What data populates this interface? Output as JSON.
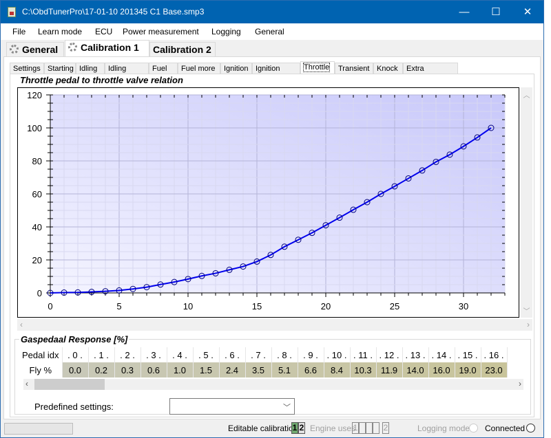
{
  "window": {
    "title": "C:\\ObdTunerPro\\17-01-10 201345 C1 Base.smp3",
    "minimize_glyph": "—",
    "maximize_glyph": "☐",
    "close_glyph": "✕"
  },
  "menu": [
    "File",
    "Learn mode",
    "ECU",
    "Power measurement",
    "Logging",
    "General"
  ],
  "main_tabs": [
    {
      "label": "General",
      "icon": "gear-icon",
      "active": false
    },
    {
      "label": "Calibration 1",
      "icon": "gear-icon",
      "active": true
    },
    {
      "label": "Calibration 2",
      "icon": null,
      "active": false
    }
  ],
  "sub_tabs": [
    "Settings",
    "Starting",
    "Idling",
    "Idling more",
    "Fuel",
    "Fuel more",
    "Ignition",
    "Ignition more",
    "Throttle",
    "Transient",
    "Knock",
    "Extra hardware"
  ],
  "active_sub_tab": "Throttle",
  "chart_group_title": "Throttle pedal to throttle valve relation",
  "chart_data": {
    "type": "line",
    "title": "Throttle pedal to throttle valve relation",
    "xlabel": "",
    "ylabel": "",
    "xlim": [
      0,
      33
    ],
    "ylim": [
      0,
      120
    ],
    "x_ticks": [
      0,
      5,
      10,
      15,
      20,
      25,
      30
    ],
    "y_ticks": [
      0,
      20,
      40,
      60,
      80,
      100,
      120
    ],
    "grid": true,
    "series_color": "#0000ee",
    "marker": "circle",
    "x": [
      0,
      1,
      2,
      3,
      4,
      5,
      6,
      7,
      8,
      9,
      10,
      11,
      12,
      13,
      14,
      15,
      16,
      17,
      18,
      19,
      20,
      21,
      22,
      23,
      24,
      25,
      26,
      27,
      28,
      29,
      30,
      31,
      32
    ],
    "y": [
      0.0,
      0.2,
      0.3,
      0.6,
      1.0,
      1.5,
      2.4,
      3.5,
      5.1,
      6.6,
      8.4,
      10.3,
      11.9,
      14.0,
      16.0,
      19.0,
      23.0,
      28.0,
      32.2,
      36.4,
      41.0,
      45.6,
      50.4,
      55.0,
      60.0,
      64.6,
      69.4,
      74.2,
      79.4,
      83.8,
      88.8,
      94.2,
      100.0
    ]
  },
  "response_table": {
    "title": "Gaspedaal Response [%]",
    "row1_header": "Pedal idx",
    "row2_header": "Fly %",
    "pedal_idx": [
      ". 0 .",
      ". 1 .",
      ". 2 .",
      ". 3 .",
      ". 4 .",
      ". 5 .",
      ". 6 .",
      ". 7 .",
      ". 8 .",
      ". 9 .",
      ". 10 .",
      ". 11 .",
      ". 12 .",
      ". 13 .",
      ". 14 .",
      ". 15 .",
      ". 16 ."
    ],
    "fly_pct": [
      "0.0",
      "0.2",
      "0.3",
      "0.6",
      "1.0",
      "1.5",
      "2.4",
      "3.5",
      "5.1",
      "6.6",
      "8.4",
      "10.3",
      "11.9",
      "14.0",
      "16.0",
      "19.0",
      "23.0"
    ]
  },
  "predefined": {
    "label": "Predefined settings:",
    "value": ""
  },
  "status": {
    "editable_label": "Editable calibration",
    "editable_boxes": [
      "1",
      "2"
    ],
    "engine_uses_label": "Engine uses",
    "engine_uses_boxes": [
      "1",
      "",
      "",
      "",
      "2"
    ],
    "logging_mode_label": "Logging mode",
    "connected_label": "Connected"
  },
  "colors": {
    "titlebar": "#0063b1",
    "editable_active": "#6fa86f",
    "cell_low": "#c8c8b8",
    "cell_high": "#c8c49a"
  }
}
